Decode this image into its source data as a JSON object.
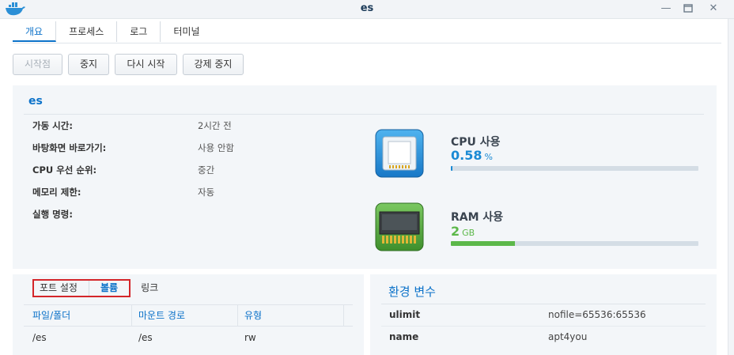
{
  "window": {
    "title": "es",
    "icon": "docker-whale-icon"
  },
  "tabs": [
    {
      "label": "개요",
      "active": true
    },
    {
      "label": "프로세스",
      "active": false
    },
    {
      "label": "로그",
      "active": false
    },
    {
      "label": "터미널",
      "active": false
    }
  ],
  "actions": {
    "start": "시작점",
    "stop": "중지",
    "restart": "다시 시작",
    "force_stop": "강제 중지"
  },
  "info": {
    "name": "es",
    "rows": [
      {
        "label": "가동 시간:",
        "value": "2시간 전"
      },
      {
        "label": "바탕화면 바로가기:",
        "value": "사용 안함"
      },
      {
        "label": "CPU 우선 순위:",
        "value": "중간"
      },
      {
        "label": "메모리 제한:",
        "value": "자동"
      },
      {
        "label": "실행 명령:",
        "value": ""
      }
    ]
  },
  "cpu": {
    "title": "CPU 사용",
    "value": "0.58",
    "unit": "%",
    "level_fraction": 0.0058,
    "color": "#1a8ad4"
  },
  "ram": {
    "title": "RAM 사용",
    "value": "2",
    "unit": "GB",
    "level_fraction": 0.26,
    "color": "#5cb84a"
  },
  "bottom_tabs": [
    {
      "label": "포트 설정",
      "active": false
    },
    {
      "label": "볼륨",
      "active": true
    },
    {
      "label": "링크",
      "active": false
    }
  ],
  "volumes": {
    "headers": [
      "파일/폴더",
      "마운트 경로",
      "유형"
    ],
    "rows": [
      [
        "/es",
        "/es",
        "rw"
      ]
    ]
  },
  "env": {
    "title": "환경 변수",
    "rows": [
      {
        "key": "ulimit",
        "value": "nofile=65536:65536"
      },
      {
        "key": "name",
        "value": "apt4you"
      }
    ]
  },
  "colors": {
    "accent": "#0c72c9",
    "highlight": "#d4262a"
  }
}
